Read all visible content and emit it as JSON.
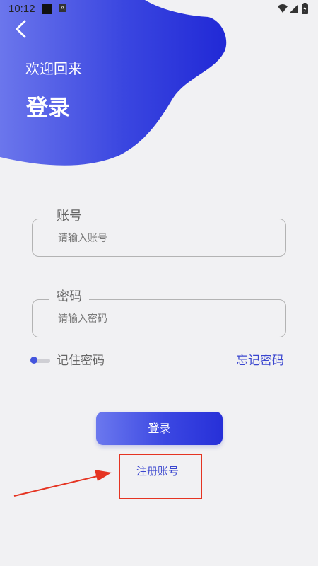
{
  "status_bar": {
    "time": "10:12",
    "notification_glyph": "A"
  },
  "header": {
    "welcome": "欢迎回来",
    "title": "登录"
  },
  "form": {
    "account": {
      "label": "账号",
      "placeholder": "请输入账号",
      "value": ""
    },
    "password": {
      "label": "密码",
      "placeholder": "请输入密码",
      "value": ""
    },
    "remember_label": "记住密码",
    "remember_checked": false,
    "forgot_label": "忘记密码",
    "login_label": "登录",
    "register_label": "注册账号"
  },
  "icons": {
    "back": "chevron-left-icon",
    "wifi": "wifi-icon",
    "signal": "signal-icon",
    "battery": "battery-icon"
  },
  "colors": {
    "accent": "#3a46cf",
    "gradient_start": "#6b78ee",
    "gradient_end": "#2730d8",
    "background": "#f1f1f3",
    "annotation": "#e53422"
  }
}
